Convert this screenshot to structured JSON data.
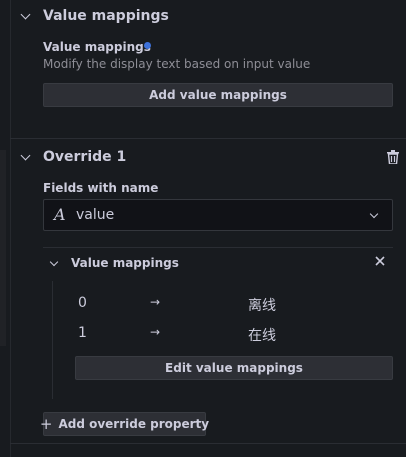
{
  "value_mappings_section": {
    "title": "Value mappings",
    "field_label": "Value mappings",
    "description": "Modify the display text based on input value",
    "add_button": "Add value mappings"
  },
  "override": {
    "title": "Override 1",
    "fields_label": "Fields with name",
    "field_value": "value",
    "field_icon": "A",
    "property": {
      "title": "Value mappings",
      "mappings": [
        {
          "from": "0",
          "arrow": "→",
          "to": "离线"
        },
        {
          "from": "1",
          "arrow": "→",
          "to": "在线"
        }
      ],
      "edit_button": "Edit value mappings"
    },
    "add_property_icon": "+",
    "add_property_button": "Add override property"
  },
  "colors": {
    "background": "#181b1f",
    "accent_dot": "#3d71d9",
    "button_bg": "#2d2f35"
  }
}
